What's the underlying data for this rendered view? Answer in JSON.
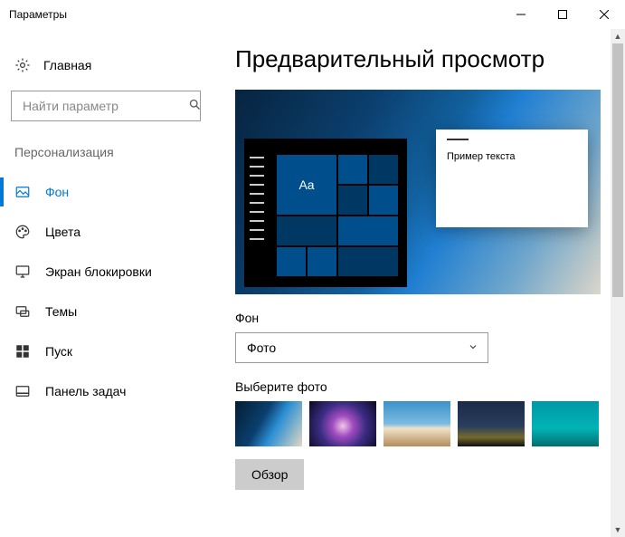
{
  "window": {
    "title": "Параметры"
  },
  "sidebar": {
    "home_label": "Главная",
    "search_placeholder": "Найти параметр",
    "section_label": "Персонализация",
    "items": [
      {
        "label": "Фон"
      },
      {
        "label": "Цвета"
      },
      {
        "label": "Экран блокировки"
      },
      {
        "label": "Темы"
      },
      {
        "label": "Пуск"
      },
      {
        "label": "Панель задач"
      }
    ]
  },
  "main": {
    "page_title": "Предварительный просмотр",
    "preview_sample_text": "Пример текста",
    "preview_tile_aa": "Aa",
    "background_label": "Фон",
    "background_value": "Фото",
    "choose_photo_label": "Выберите фото",
    "browse_label": "Обзор"
  }
}
